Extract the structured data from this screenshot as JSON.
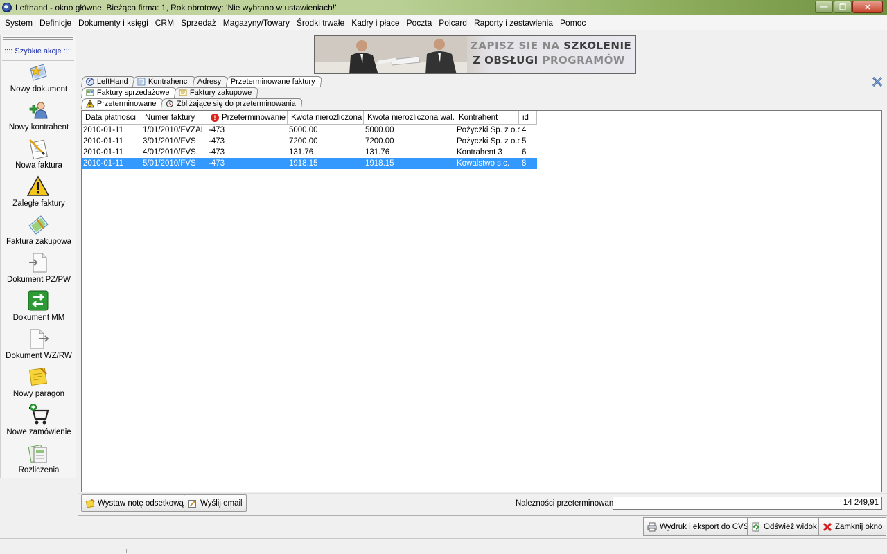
{
  "window": {
    "title": "Lefthand - okno główne. Bieżąca firma: 1, Rok obrotowy: 'Nie wybrano w ustawieniach!'",
    "min": "—",
    "max": "❐",
    "close": "✕"
  },
  "menu": [
    "System",
    "Definicje",
    "Dokumenty i księgi",
    "CRM",
    "Sprzedaż",
    "Magazyny/Towary",
    "Środki trwałe",
    "Kadry i płace",
    "Poczta",
    "Polcard",
    "Raporty i zestawienia",
    "Pomoc"
  ],
  "sidebar": {
    "header": ":::: Szybkie akcje ::::",
    "items": [
      {
        "label": "Nowy dokument",
        "icon": "new-document-icon"
      },
      {
        "label": "Nowy kontrahent",
        "icon": "add-contractor-icon"
      },
      {
        "label": "Nowa faktura",
        "icon": "new-invoice-icon"
      },
      {
        "label": "Zaległe faktury",
        "icon": "overdue-warning-icon"
      },
      {
        "label": "Faktura zakupowa",
        "icon": "purchase-invoice-icon"
      },
      {
        "label": "Dokument PZ/PW",
        "icon": "document-pz-icon"
      },
      {
        "label": "Dokument MM",
        "icon": "document-mm-icon"
      },
      {
        "label": "Dokument WZ/RW",
        "icon": "document-wz-icon"
      },
      {
        "label": "Nowy paragon",
        "icon": "receipt-icon"
      },
      {
        "label": "Nowe zamówienie",
        "icon": "cart-icon"
      },
      {
        "label": "Rozliczenia",
        "icon": "settlements-icon"
      }
    ]
  },
  "banner": {
    "line1a": "ZAPISZ SIE NA ",
    "line1b": "SZKOLENIE",
    "line2a": "Z OBSŁUGI ",
    "line2b": "PROGRAMÓW"
  },
  "tabs": {
    "main": [
      "LeftHand",
      "Kontrahenci",
      "Adresy",
      "Przeterminowane faktury"
    ],
    "sub": [
      "Faktury sprzedażowe",
      "Faktury zakupowe"
    ],
    "inner": [
      "Przeterminowane",
      "Zbliżające się do przeterminowania"
    ]
  },
  "grid": {
    "columns": [
      "Data płatności",
      "Numer faktury",
      "Przeterminowanie",
      "Kwota nierozliczona",
      "Kwota nierozliczona wal.",
      "Kontrahent",
      "id"
    ],
    "rows": [
      [
        "2010-01-11",
        "1/01/2010/FVZAL",
        "-473",
        "5000.00",
        "5000.00",
        "Pożyczki Sp. z o.o.",
        "4"
      ],
      [
        "2010-01-11",
        "3/01/2010/FVS",
        "-473",
        "7200.00",
        "7200.00",
        "Pożyczki Sp. z o.o.",
        "5"
      ],
      [
        "2010-01-11",
        "4/01/2010/FVS",
        "-473",
        "131.76",
        "131.76",
        "Kontrahent 3",
        "6"
      ],
      [
        "2010-01-11",
        "5/01/2010/FVS",
        "-473",
        "1918.15",
        "1918.15",
        "Kowalstwo s.c.",
        "8"
      ]
    ],
    "selected_index": 3
  },
  "actions": {
    "note": "Wystaw notę odsetkową",
    "email": "Wyślij email",
    "sum_label": "Należności przeterminowane:",
    "sum_value": "14 249,91"
  },
  "footer": {
    "print": "Wydruk i eksport do CVS",
    "refresh": "Odśwież widok",
    "close": "Zamknij okno"
  },
  "colors": {
    "selection": "#3399ff",
    "sidebar_header": "#1a2ea8"
  }
}
